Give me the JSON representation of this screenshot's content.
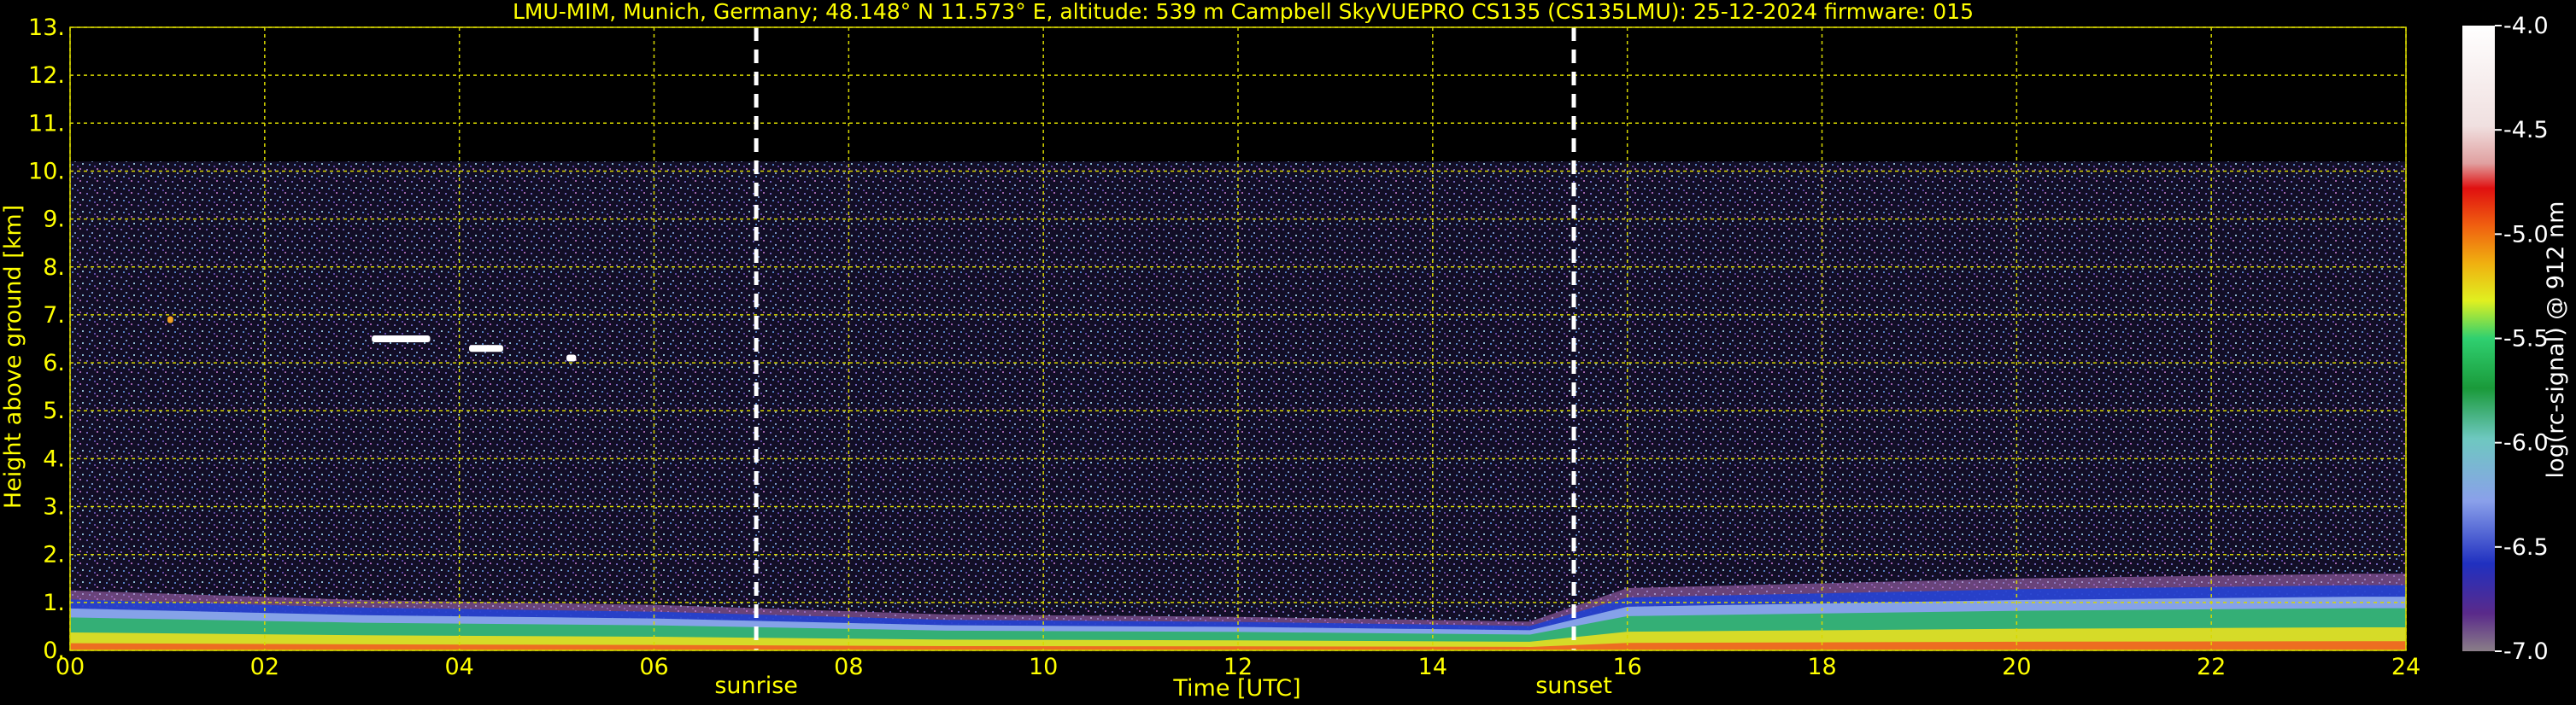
{
  "chart_data": {
    "type": "heatmap",
    "title": "LMU-MIM, Munich, Germany; 48.148° N 11.573° E, altitude: 539 m    Campbell SkyVUEPRO CS135 (CS135LMU): 25-12-2024    firmware: 015",
    "xlabel": "Time [UTC]",
    "ylabel": "Height above ground [km]",
    "xlim": [
      0,
      24
    ],
    "ylim": [
      0,
      13
    ],
    "x_ticks": [
      "00",
      "02",
      "04",
      "06",
      "08",
      "10",
      "12",
      "14",
      "16",
      "18",
      "20",
      "22",
      "24"
    ],
    "y_ticks": [
      "0.",
      "1.",
      "2.",
      "3.",
      "4.",
      "5.",
      "6.",
      "7.",
      "8.",
      "9.",
      "10.",
      "11.",
      "12.",
      "13."
    ],
    "grid": true,
    "colorbar": {
      "label": "log(rc-signal) @ 912 nm",
      "range": [
        -7.0,
        -4.0
      ],
      "ticks": [
        "-4.0",
        "-4.5",
        "-5.0",
        "-5.5",
        "-6.0",
        "-6.5",
        "-7.0"
      ]
    },
    "markers": [
      {
        "label": "sunrise",
        "x": 7.05
      },
      {
        "label": "sunset",
        "x": 15.45
      }
    ],
    "signal_top_km": 10.2,
    "boundary_layer": [
      {
        "t": 0,
        "top_km": 1.25
      },
      {
        "t": 3,
        "top_km": 1.05
      },
      {
        "t": 6,
        "top_km": 0.95
      },
      {
        "t": 9,
        "top_km": 0.75
      },
      {
        "t": 12,
        "top_km": 0.7
      },
      {
        "t": 15,
        "top_km": 0.6
      },
      {
        "t": 16,
        "top_km": 1.3
      },
      {
        "t": 20,
        "top_km": 1.5
      },
      {
        "t": 23.5,
        "top_km": 1.6
      }
    ],
    "cloud_patches": [
      {
        "t_start": 3.1,
        "t_end": 3.7,
        "h_km": 6.5
      },
      {
        "t_start": 4.1,
        "t_end": 4.45,
        "h_km": 6.3
      },
      {
        "t_start": 5.1,
        "t_end": 5.2,
        "h_km": 6.1
      },
      {
        "t_start": 1.0,
        "t_end": 1.06,
        "h_km": 6.9
      }
    ]
  }
}
